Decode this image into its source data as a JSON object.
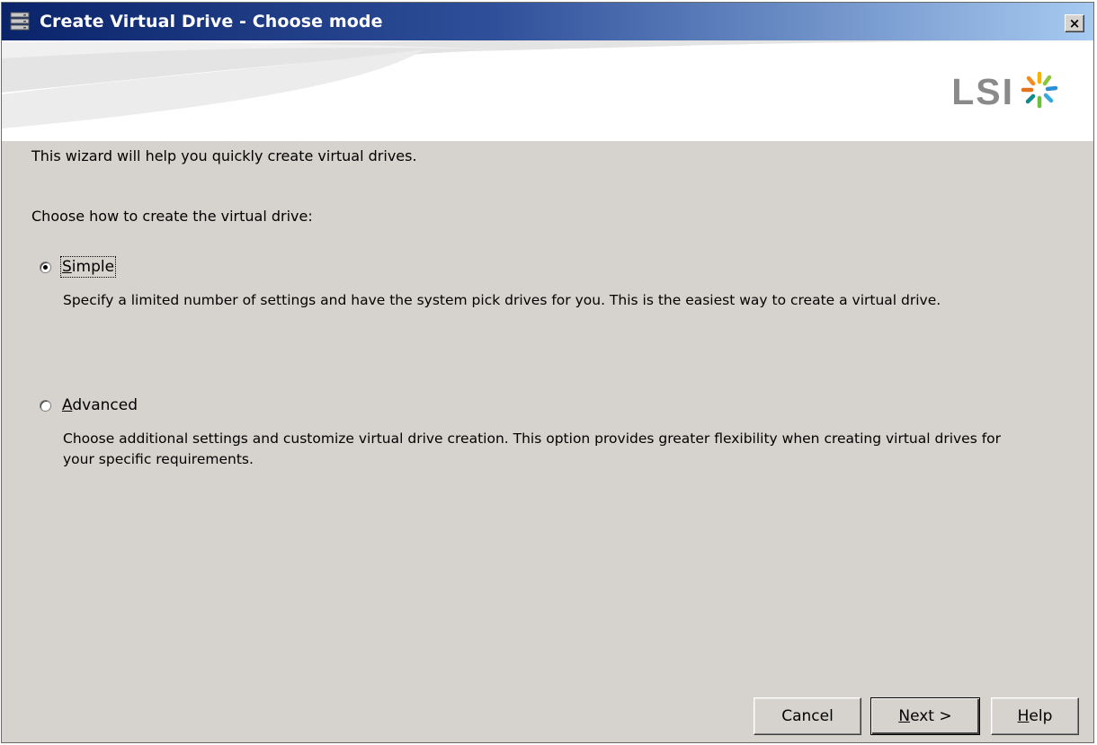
{
  "window": {
    "title": "Create Virtual Drive - Choose mode",
    "close_glyph": "×",
    "title_icon": "drive-stack-icon"
  },
  "banner": {
    "logo_text": "LSI",
    "logo_icon": "lsi-starburst-icon"
  },
  "body": {
    "intro": "This wizard will help you quickly create virtual drives.",
    "prompt": "Choose how to create the virtual drive:"
  },
  "options": {
    "simple": {
      "label_mnemonic": "S",
      "label_rest": "imple",
      "selected": true,
      "description": "Specify a limited number of settings and have the system pick drives for you. This is the easiest way to create a virtual drive."
    },
    "advanced": {
      "label_mnemonic": "A",
      "label_rest": "dvanced",
      "selected": false,
      "description": "Choose additional settings and customize virtual drive creation. This option provides greater flexibility when creating virtual drives for your specific requirements."
    }
  },
  "buttons": {
    "cancel": "Cancel",
    "next_mnemonic": "N",
    "next_rest": "ext >",
    "help_mnemonic": "H",
    "help_rest": "elp"
  },
  "colors": {
    "titlebar_start": "#0a246a",
    "titlebar_end": "#a6caf0",
    "dialog_bg": "#d6d3ce",
    "logo_gray": "#8a8a8a"
  }
}
